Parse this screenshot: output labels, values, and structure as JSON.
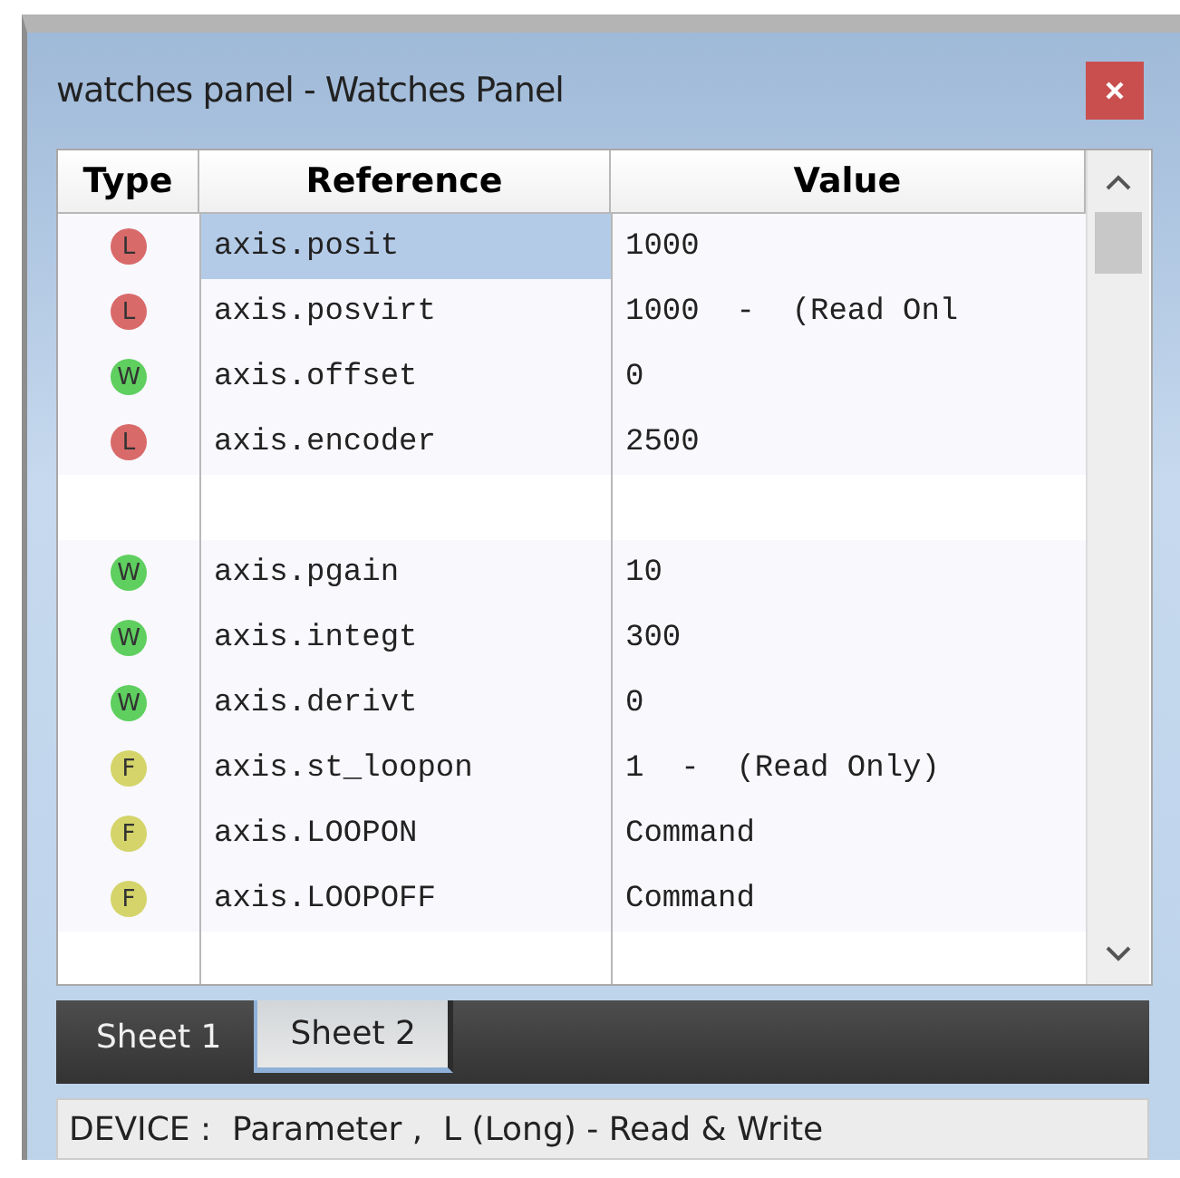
{
  "window": {
    "title": "watches panel - Watches Panel"
  },
  "table": {
    "columns": [
      "Type",
      "Reference",
      "Value"
    ],
    "rows": [
      {
        "kind": "watch",
        "type": "L",
        "color": "#d96a6a",
        "reference": "axis.posit",
        "value": "1000",
        "selected": true
      },
      {
        "kind": "watch",
        "type": "L",
        "color": "#d96a6a",
        "reference": "axis.posvirt",
        "value": "1000  -  (Read Onl",
        "selected": false
      },
      {
        "kind": "watch",
        "type": "W",
        "color": "#5fcf5f",
        "reference": "axis.offset",
        "value": "0",
        "selected": false
      },
      {
        "kind": "watch",
        "type": "L",
        "color": "#d96a6a",
        "reference": "axis.encoder",
        "value": "2500",
        "selected": false
      },
      {
        "kind": "blank"
      },
      {
        "kind": "watch",
        "type": "W",
        "color": "#5fcf5f",
        "reference": "axis.pgain",
        "value": "10",
        "selected": false
      },
      {
        "kind": "watch",
        "type": "W",
        "color": "#5fcf5f",
        "reference": "axis.integt",
        "value": "300",
        "selected": false
      },
      {
        "kind": "watch",
        "type": "W",
        "color": "#5fcf5f",
        "reference": "axis.derivt",
        "value": "0",
        "selected": false
      },
      {
        "kind": "watch",
        "type": "F",
        "color": "#d4d46a",
        "reference": "axis.st_loopon",
        "value": "1  -  (Read Only)",
        "selected": false
      },
      {
        "kind": "watch",
        "type": "F",
        "color": "#d4d46a",
        "reference": "axis.LOOPON",
        "value": "Command",
        "selected": false
      },
      {
        "kind": "watch",
        "type": "F",
        "color": "#d4d46a",
        "reference": "axis.LOOPOFF",
        "value": "Command",
        "selected": false
      }
    ]
  },
  "tabs": [
    {
      "label": "Sheet 1",
      "selected": false
    },
    {
      "label": "Sheet 2",
      "selected": true
    }
  ],
  "status_bar": "DEVICE :  Parameter ,  L (Long) - Read & Write"
}
